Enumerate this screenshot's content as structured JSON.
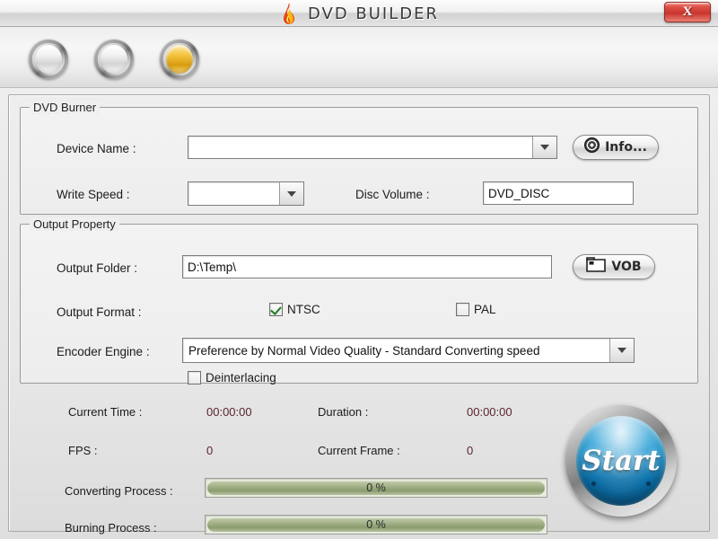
{
  "window": {
    "title": "DVD BUILDER",
    "flame_icon": "flame-icon",
    "close_label": "X"
  },
  "toolbar": {
    "buttons": [
      {
        "name": "disc-button-1",
        "state": "inactive"
      },
      {
        "name": "disc-button-2",
        "state": "inactive"
      },
      {
        "name": "disc-button-3",
        "state": "active"
      }
    ]
  },
  "burner_group": {
    "legend": "DVD Burner",
    "device_name_label": "Device Name :",
    "device_name_value": "",
    "info_button_label": "Info...",
    "info_button_icon": "disc-icon",
    "write_speed_label": "Write Speed :",
    "write_speed_value": "",
    "disc_volume_label": "Disc Volume :",
    "disc_volume_value": "DVD_DISC"
  },
  "output_group": {
    "legend": "Output Property",
    "output_folder_label": "Output Folder :",
    "output_folder_value": "D:\\Temp\\",
    "vob_button_label": "VOB",
    "vob_button_icon": "folder-icon",
    "output_format_label": "Output Format :",
    "ntsc_label": "NTSC",
    "ntsc_checked": true,
    "pal_label": "PAL",
    "pal_checked": false,
    "encoder_engine_label": "Encoder Engine :",
    "encoder_engine_value": "Preference by Normal Video Quality - Standard Converting speed",
    "deinterlacing_label": "Deinterlacing",
    "deinterlacing_checked": false
  },
  "status": {
    "current_time_label": "Current Time :",
    "current_time_value": "00:00:00",
    "duration_label": "Duration :",
    "duration_value": "00:00:00",
    "fps_label": "FPS :",
    "fps_value": "0",
    "current_frame_label": "Current Frame :",
    "current_frame_value": "0",
    "converting_label": "Converting Process :",
    "converting_percent": 0,
    "converting_text": "0 %",
    "burning_label": "Burning Process :",
    "burning_percent": 0,
    "burning_text": "0 %"
  },
  "start_button": {
    "label": "Start"
  },
  "colors": {
    "close_red": "#c8352b",
    "active_disc_gold": "#f3c43f",
    "checkmark_green": "#1c7a1c",
    "status_value": "#5a2330",
    "progress_fill": "#9fae84",
    "start_blue": "#2e9fd4"
  }
}
